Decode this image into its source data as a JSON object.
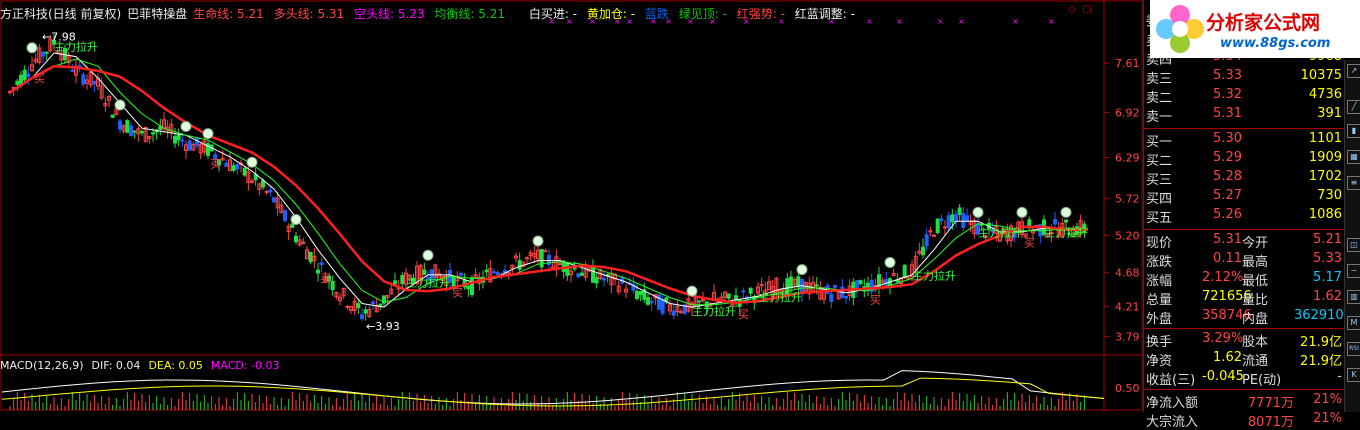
{
  "header": {
    "title": "方正科技(日线 前复权)",
    "indicator": "巴菲特操盘",
    "life_label": "生命线: 5.21",
    "long_label": "多头线: 5.31",
    "short_label": "空头线: 5.23",
    "balance_label": "均衡线: 5.21",
    "buy_label": "白买进: -",
    "yellow_label": "黄加仓: -",
    "blue_label": "蓝跌",
    "green_label": "绿见顶: -",
    "red_label": "红强势: -",
    "adjust_label": "红蓝调整: -"
  },
  "macd": {
    "name": "MACD(12,26,9)",
    "dif": "DIF: 0.04",
    "dea": "DEA: 0.05",
    "macd": "MACD: -0.03"
  },
  "y_axis": [
    "7.61",
    "6.92",
    "6.29",
    "5.72",
    "5.20",
    "4.68",
    "4.21",
    "3.79"
  ],
  "macd_axis": "0.50",
  "annotations": {
    "high_mark": "7.98",
    "low_mark": "3.93",
    "buy": "买",
    "main_up": "主力拉升"
  },
  "chart_data": {
    "type": "line",
    "series": [
      {
        "values": [
          7.2,
          7.6,
          7.9,
          7.5,
          7.3,
          6.8,
          6.6,
          6.7,
          6.5,
          6.4,
          6.2,
          6.0,
          5.7,
          5.2,
          4.8,
          4.4,
          4.1,
          4.3,
          4.6,
          4.7,
          4.6,
          4.5,
          4.7,
          4.8,
          4.9,
          4.8,
          4.7,
          4.6,
          4.5,
          4.3,
          4.2,
          4.2,
          4.3,
          4.3,
          4.4,
          4.5,
          4.5,
          4.4,
          4.4,
          4.5,
          4.6,
          4.7,
          5.3,
          5.5,
          5.3,
          5.2,
          5.3,
          5.3,
          5.3,
          5.3
        ]
      }
    ],
    "ylim": [
      3.79,
      7.98
    ]
  },
  "quote": {
    "asks": [
      {
        "label": "卖五",
        "price": "",
        "vol": ""
      },
      {
        "label": "卖四",
        "price": "5.34",
        "vol": "9968"
      },
      {
        "label": "卖三",
        "price": "5.33",
        "vol": "10375"
      },
      {
        "label": "卖二",
        "price": "5.32",
        "vol": "4736"
      },
      {
        "label": "卖一",
        "price": "5.31",
        "vol": "391"
      }
    ],
    "bids": [
      {
        "label": "买一",
        "price": "5.30",
        "vol": "1101"
      },
      {
        "label": "买二",
        "price": "5.29",
        "vol": "1909"
      },
      {
        "label": "买三",
        "price": "5.28",
        "vol": "1702"
      },
      {
        "label": "买四",
        "price": "5.27",
        "vol": "730"
      },
      {
        "label": "买五",
        "price": "5.26",
        "vol": "1086"
      }
    ],
    "stats": [
      {
        "l1": "现价",
        "v1": "5.31",
        "l2": "今开",
        "v2": "5.21"
      },
      {
        "l1": "涨跌",
        "v1": "0.11",
        "l2": "最高",
        "v2": "5.33"
      },
      {
        "l1": "涨幅",
        "v1": "2.12%",
        "l2": "最低",
        "v2": "5.17"
      },
      {
        "l1": "总量",
        "v1": "721656",
        "l2": "量比",
        "v2": "1.62"
      },
      {
        "l1": "外盘",
        "v1": "358746",
        "l2": "内盘",
        "v2": "362910"
      },
      {
        "l1": "换手",
        "v1": "3.29%",
        "l2": "股本",
        "v2": "21.9亿"
      },
      {
        "l1": "净资",
        "v1": "1.62",
        "l2": "流通",
        "v2": "21.9亿"
      },
      {
        "l1": "收益(三)",
        "v1": "-0.045",
        "l2": "PE(动)",
        "v2": "-"
      }
    ],
    "flows": [
      {
        "label": "净流入额",
        "v1": "7771万",
        "v2": "21%"
      },
      {
        "label": "大宗流入",
        "v1": "8071万",
        "v2": "21%"
      }
    ],
    "top_label": "委"
  },
  "logo": {
    "name": "分析家公式网",
    "url": "www.88gs.com"
  },
  "colors": {
    "up": "#ff4444",
    "down": "#00cc00",
    "grid": "#a00000",
    "ma_red": "#ff2020",
    "ma_white": "#ffffff",
    "ma_green": "#22ff22"
  }
}
